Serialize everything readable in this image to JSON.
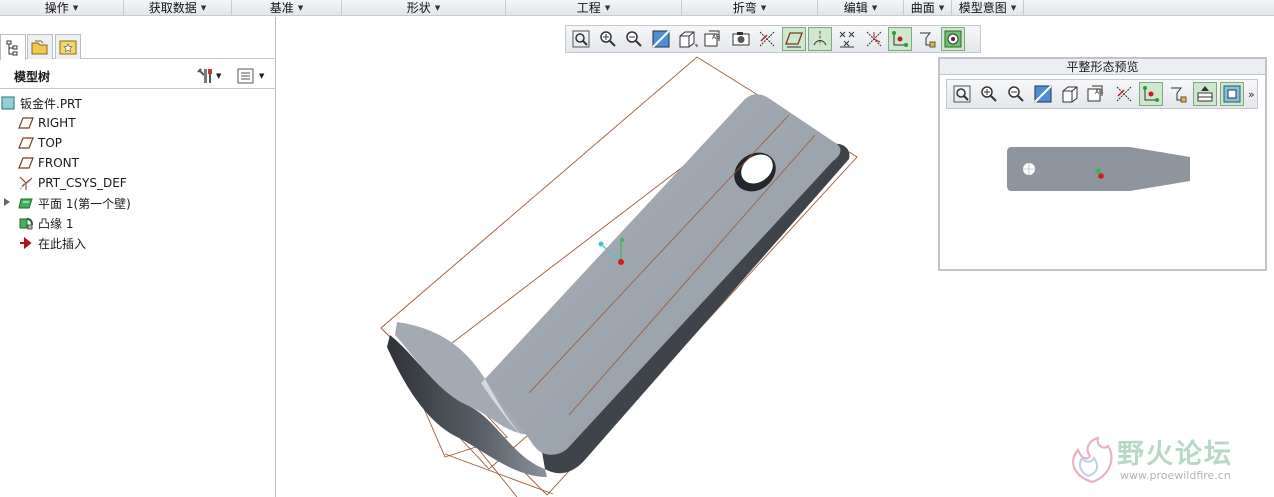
{
  "menubar": {
    "items": [
      {
        "label": "操作"
      },
      {
        "label": "获取数据"
      },
      {
        "label": "基准"
      },
      {
        "label": "形状"
      },
      {
        "label": "工程"
      },
      {
        "label": "折弯"
      },
      {
        "label": "编辑"
      },
      {
        "label": "曲面"
      },
      {
        "label": "模型意图"
      }
    ]
  },
  "model_tree": {
    "title": "模型树",
    "items": [
      {
        "label": "钣金件.PRT",
        "icon": "part-icon"
      },
      {
        "label": "RIGHT",
        "icon": "datum-plane-icon"
      },
      {
        "label": "TOP",
        "icon": "datum-plane-icon"
      },
      {
        "label": "FRONT",
        "icon": "datum-plane-icon"
      },
      {
        "label": "PRT_CSYS_DEF",
        "icon": "csys-icon"
      },
      {
        "label": "平面 1(第一个壁)",
        "icon": "flat-wall-icon"
      },
      {
        "label": "凸缘 1",
        "icon": "flange-icon"
      },
      {
        "label": "在此插入",
        "icon": "insert-here-arrow-icon"
      }
    ]
  },
  "preview": {
    "title": "平整形态预览"
  },
  "watermark": {
    "text": "野火论坛",
    "url": "www.proewildfire.cn"
  },
  "colors": {
    "part_gray": "#9ba3ad",
    "part_dark": "#4a4f55",
    "bbox_line": "#9b5a34",
    "active_button": "#cfe6cf"
  }
}
